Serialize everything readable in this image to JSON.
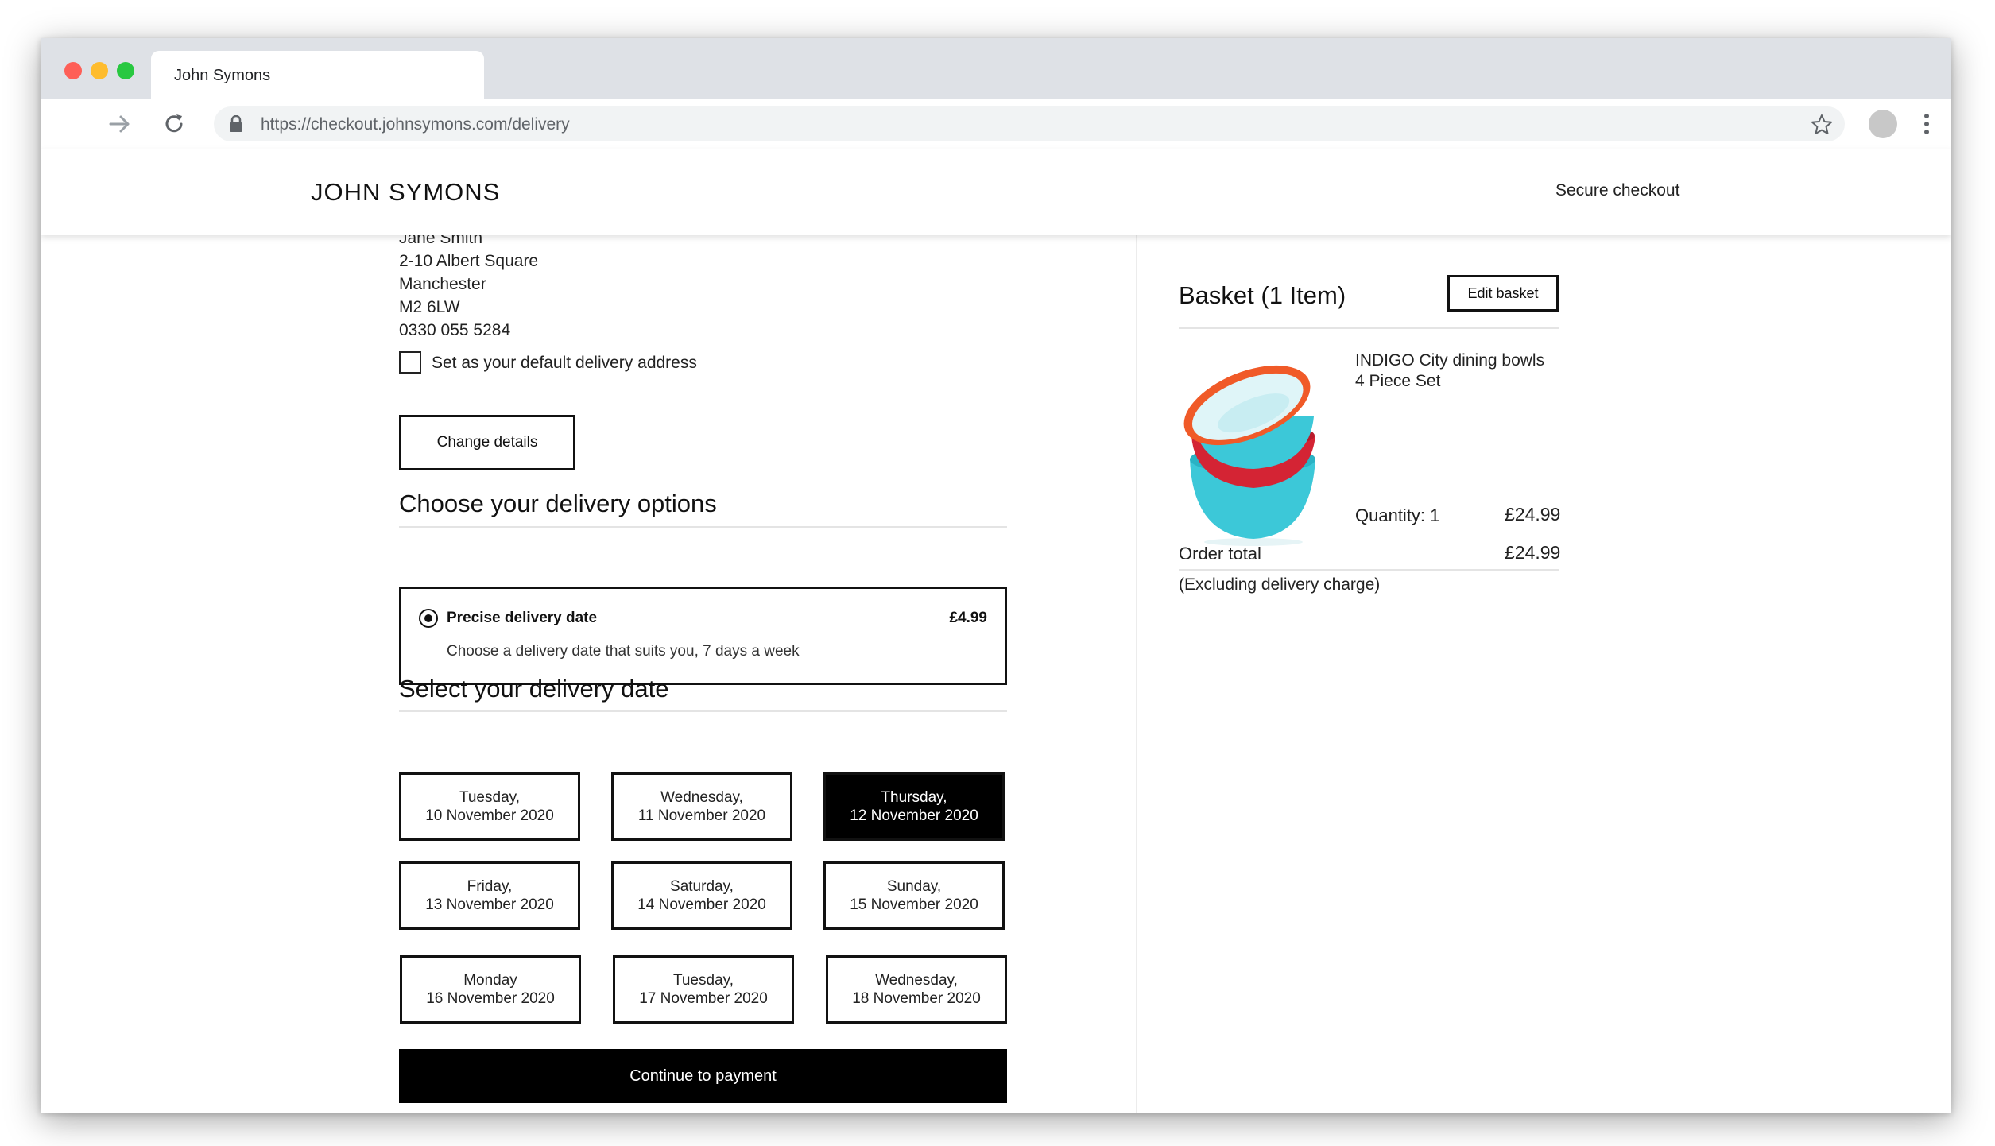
{
  "browser": {
    "tab_title": "John Symons",
    "url": "https://checkout.johnsymons.com/delivery"
  },
  "header": {
    "logo": "JOHN SYMONS",
    "secure_text": "Secure checkout"
  },
  "address": {
    "lines": [
      "Jane Smith",
      "2-10 Albert Square",
      "Manchester",
      "M2 6LW",
      "0330 055 5284"
    ],
    "default_checkbox_label": "Set as your default delivery address",
    "default_checked": false,
    "change_button": "Change details"
  },
  "delivery_options": {
    "title": "Choose your delivery options",
    "option": {
      "name": "Precise delivery date",
      "price": "£4.99",
      "description": "Choose a delivery date that suits you, 7 days a week",
      "selected": true
    }
  },
  "delivery_date": {
    "title": "Select your delivery date",
    "dates": [
      {
        "day": "Tuesday,",
        "date": "10 November 2020"
      },
      {
        "day": "Wednesday,",
        "date": "11 November 2020"
      },
      {
        "day": "Thursday,",
        "date": "12 November 2020"
      },
      {
        "day": "Friday,",
        "date": "13 November 2020"
      },
      {
        "day": "Saturday,",
        "date": "14 November 2020"
      },
      {
        "day": "Sunday,",
        "date": "15 November 2020"
      },
      {
        "day": "Monday",
        "date": "16 November 2020"
      },
      {
        "day": "Tuesday,",
        "date": "17 November 2020"
      },
      {
        "day": "Wednesday,",
        "date": "18 November 2020"
      }
    ],
    "selected": "12 November 2020",
    "continue_button": "Continue to payment"
  },
  "basket": {
    "title": "Basket (1 Item)",
    "edit_button": "Edit basket",
    "item": {
      "name_line1": "INDIGO City dining bowls",
      "name_line2": "4 Piece Set",
      "quantity": "Quantity: 1",
      "price": "£24.99"
    },
    "order_total_label": "Order total",
    "order_total_value": "£24.99",
    "order_total_note": "(Excluding delivery charge)"
  },
  "colors": {
    "accent": "#000000",
    "bowl_orange": "#f05a28",
    "bowl_red": "#d42434",
    "bowl_teal": "#3cc8d8"
  }
}
